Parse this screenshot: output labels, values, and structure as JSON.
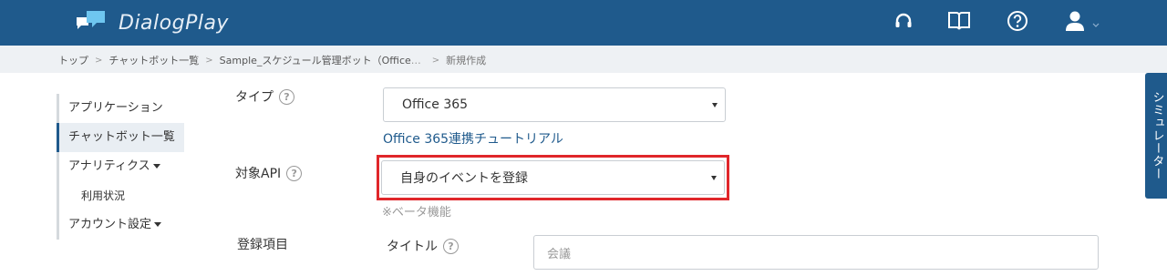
{
  "header": {
    "app_name": "DialogPlay"
  },
  "breadcrumb": {
    "items": [
      "トップ",
      "チャットボット一覧",
      "Sample_スケジュール管理ボット（Office",
      "…",
      "新規作成"
    ],
    "separator": ">"
  },
  "sidebar": {
    "items": [
      {
        "label": "アプリケーション"
      },
      {
        "label": "チャットボット一覧"
      },
      {
        "label": "アナリティクス"
      },
      {
        "label": "利用状況"
      },
      {
        "label": "アカウント設定"
      }
    ]
  },
  "form": {
    "type_label": "タイプ",
    "type_value": "Office 365",
    "tutorial_link": "Office 365連携チュートリアル",
    "api_label": "対象API",
    "api_value": "自身のイベントを登録",
    "beta_note": "※ベータ機能",
    "items_label": "登録項目",
    "title_label": "タイトル",
    "title_placeholder": "会議"
  },
  "simulator": {
    "label": "シミュレーター"
  },
  "colors": {
    "brand": "#1f5a8c",
    "highlight": "#e0262a"
  },
  "icons": [
    "chat-bubbles-logo-icon",
    "headset-icon",
    "book-icon",
    "question-icon",
    "user-icon",
    "chevron-down-icon",
    "help-icon"
  ]
}
